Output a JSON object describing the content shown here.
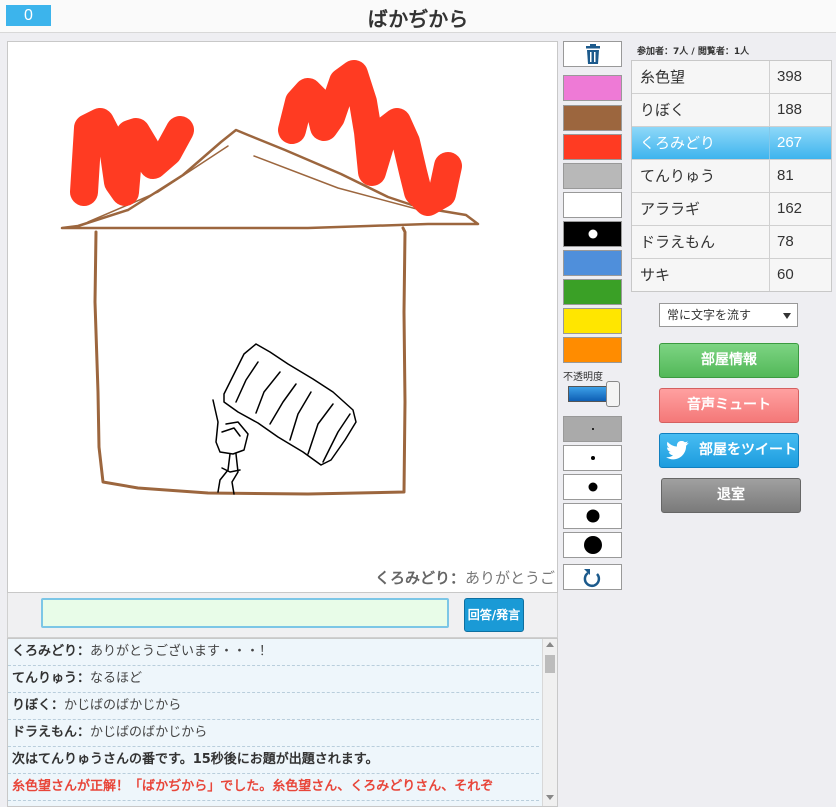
{
  "header": {
    "counter": "0",
    "title": "ばかぢから"
  },
  "canvas": {
    "message_name": "くろみどり：",
    "message_text": "ありがとうございます・・・！"
  },
  "answer": {
    "input_value": "",
    "button_label": "回答/発言"
  },
  "chat": [
    {
      "name": "くろみどり：",
      "text": "ありがとうございます・・・！"
    },
    {
      "name": "てんりゅう：",
      "text": "なるほど"
    },
    {
      "name": "りぼく：",
      "text": "かじばのばかじから"
    },
    {
      "name": "ドラえもん：",
      "text": "かじばのばかじから"
    }
  ],
  "system_message": "次はてんりゅうさんの番です。15秒後にお題が出題されます。",
  "correct_message": "糸色望さんが正解！「ばかぢから」でした。糸色望さん、くろみどりさん、それぞ",
  "tools": {
    "trash_icon": "trash-icon",
    "colors": [
      "#ee7ad6",
      "#9c663e",
      "#ff3b22",
      "#b8b8b8",
      "#ffffff",
      "#000000",
      "#4f8fdb",
      "#3aa026",
      "#ffe600",
      "#ff8c00"
    ],
    "opacity_label": "不透明度",
    "undo_icon": "undo-icon"
  },
  "room": {
    "info_text": "参加者：7人 / 閲覧者：1人",
    "players": [
      {
        "name": "糸色望",
        "score": "398"
      },
      {
        "name": "りぼく",
        "score": "188"
      },
      {
        "name": "くろみどり",
        "score": "267"
      },
      {
        "name": "てんりゅう",
        "score": "81"
      },
      {
        "name": "アララギ",
        "score": "162"
      },
      {
        "name": "ドラえもん",
        "score": "78"
      },
      {
        "name": "サキ",
        "score": "60"
      }
    ],
    "highlight_index": 2,
    "select_value": "常に文字を流す",
    "buttons": {
      "room_info": "部屋情報",
      "mute": "音声ミュート",
      "tweet": "部屋をツイート",
      "exit": "退室"
    }
  }
}
